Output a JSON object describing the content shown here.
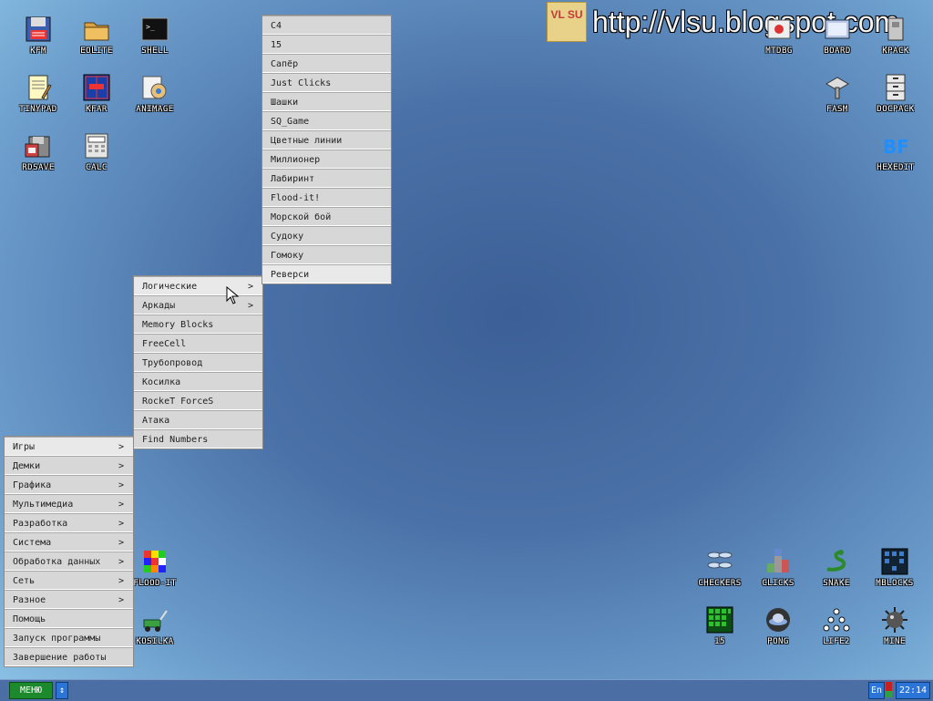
{
  "watermark": {
    "logo_text": "VL SU",
    "url": "http://vlsu.blogspot.com"
  },
  "desktop_icons": {
    "kfm": "KFM",
    "eolite": "EOLITE",
    "shell": "SHELL",
    "tinypad": "TINYPAD",
    "kfar": "KFAR",
    "animage": "ANIMAGE",
    "rdsave": "RDSAVE",
    "calc": "CALC",
    "mtdbg": "MTDBG",
    "board": "BOARD",
    "kpack": "KPACK",
    "fasm": "FASM",
    "docpack": "DOCPACK",
    "hexedit": "HEXEDIT",
    "floodit": "FLOOD-IT",
    "kosilka": "KOSILKA",
    "checkers": "CHECKERS",
    "clicks": "CLICKS",
    "snake": "SNAKE",
    "mblocks": "MBLOCKS",
    "fifteen": "15",
    "pong": "PONG",
    "life2": "LIFE2",
    "mine": "MINE"
  },
  "main_menu": {
    "items": [
      {
        "label": "Игры",
        "arrow": ">"
      },
      {
        "label": "Демки",
        "arrow": ">"
      },
      {
        "label": "Графика",
        "arrow": ">"
      },
      {
        "label": "Мультимедиа",
        "arrow": ">"
      },
      {
        "label": "Разработка",
        "arrow": ">"
      },
      {
        "label": "Система",
        "arrow": ">"
      },
      {
        "label": "Обработка данных",
        "arrow": ">"
      },
      {
        "label": "Сеть",
        "arrow": ">"
      },
      {
        "label": "Разное",
        "arrow": ">"
      },
      {
        "label": "Помощь",
        "arrow": ""
      },
      {
        "label": "Запуск программы",
        "arrow": ""
      },
      {
        "label": "Завершение работы",
        "arrow": ""
      }
    ]
  },
  "games_menu": {
    "items": [
      {
        "label": "Логические",
        "arrow": ">"
      },
      {
        "label": "Аркады",
        "arrow": ">"
      },
      {
        "label": "Memory Blocks",
        "arrow": ""
      },
      {
        "label": "FreeCell",
        "arrow": ""
      },
      {
        "label": "Трубопровод",
        "arrow": ""
      },
      {
        "label": "Косилка",
        "arrow": ""
      },
      {
        "label": "RockeT ForceS",
        "arrow": ""
      },
      {
        "label": "Атака",
        "arrow": ""
      },
      {
        "label": "Find Numbers",
        "arrow": ""
      }
    ]
  },
  "logic_menu": {
    "items": [
      "C4",
      "15",
      "Сапёр",
      "Just Clicks",
      "Шашки",
      "SQ_Game",
      "Цветные линии",
      "Миллионер",
      "Лабиринт",
      "Flood-it!",
      "Морской бой",
      "Судоку",
      "Гомоку",
      "Реверси"
    ]
  },
  "taskbar": {
    "menu_label": "МЕНЮ",
    "scroll_label": "↕",
    "lang": "En",
    "clock": "22:14"
  }
}
